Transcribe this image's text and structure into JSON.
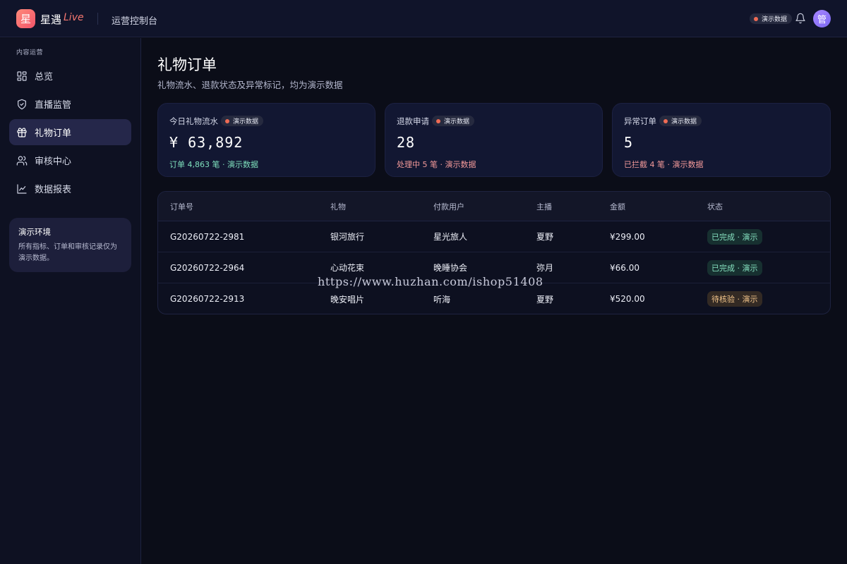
{
  "header": {
    "logo_char": "星",
    "brand": "星遇",
    "brand_live": "Live",
    "console_title": "运营控制台",
    "demo_badge": "演示数据",
    "avatar_char": "管"
  },
  "sidebar": {
    "section_label": "内容运营",
    "items": [
      {
        "label": "总览",
        "icon": "grid-icon"
      },
      {
        "label": "直播监管",
        "icon": "shield-check-icon"
      },
      {
        "label": "礼物订单",
        "icon": "gift-icon",
        "active": true
      },
      {
        "label": "审核中心",
        "icon": "users-icon"
      },
      {
        "label": "数据报表",
        "icon": "line-chart-icon"
      }
    ],
    "env_card": {
      "title": "演示环境",
      "text": "所有指标、订单和审核记录仅为演示数据。"
    }
  },
  "main": {
    "title": "礼物订单",
    "subtitle": "礼物流水、退款状态及异常标记，均为演示数据",
    "stats": [
      {
        "label": "今日礼物流水",
        "badge": "演示数据",
        "value": "¥ 63,892",
        "foot": "订单 4,863 笔 · 演示数据",
        "foot_color": "#7fe0bd"
      },
      {
        "label": "退款申请",
        "badge": "演示数据",
        "value": "28",
        "foot": "处理中 5 笔 · 演示数据",
        "foot_color": "#f49a9a"
      },
      {
        "label": "异常订单",
        "badge": "演示数据",
        "value": "5",
        "foot": "已拦截 4 笔 · 演示数据",
        "foot_color": "#f49a9a"
      }
    ],
    "table": {
      "columns": [
        "订单号",
        "礼物",
        "付款用户",
        "主播",
        "金额",
        "状态"
      ],
      "rows": [
        {
          "order_id": "G20260722-2981",
          "gift": "银河旅行",
          "payer": "星光旅人",
          "host": "夏野",
          "amount": "¥299.00",
          "status": "已完成 · 演示",
          "status_type": "done"
        },
        {
          "order_id": "G20260722-2964",
          "gift": "心动花束",
          "payer": "晚睡协会",
          "host": "弥月",
          "amount": "¥66.00",
          "status": "已完成 · 演示",
          "status_type": "done"
        },
        {
          "order_id": "G20260722-2913",
          "gift": "晚安唱片",
          "payer": "听海",
          "host": "夏野",
          "amount": "¥520.00",
          "status": "待核验 · 演示",
          "status_type": "wait"
        }
      ]
    }
  },
  "watermark": "https://www.huzhan.com/ishop51408",
  "colors": {
    "accent_red": "#ef6b55",
    "success_green": "#7fe0bd",
    "warning_pink": "#f49a9a"
  }
}
